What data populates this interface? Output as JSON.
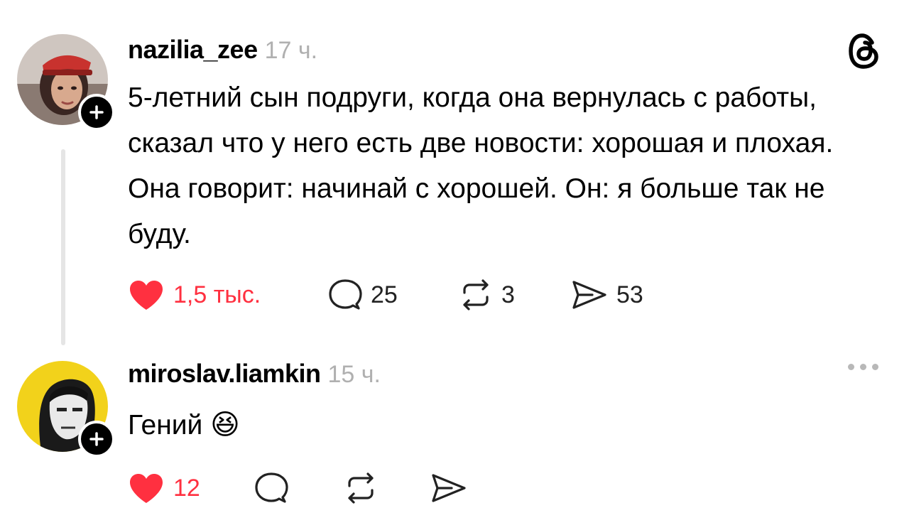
{
  "posts": [
    {
      "username": "nazilia_zee",
      "time": "17 ч.",
      "text": "5-летний сын подруги, когда она вернулась с работы, сказал что у него есть две новости: хорошая и плохая. Она говорит: начинай с хорошей. Он: я больше так не буду.",
      "likes": "1,5 тыс.",
      "comments": "25",
      "reposts": "3",
      "shares": "53",
      "liked": true
    },
    {
      "username": "miroslav.liamkin",
      "time": "15 ч.",
      "text": "Гений",
      "emoji": "😆",
      "likes": "12",
      "liked": true
    }
  ],
  "icons": {
    "logo": "threads-logo-icon",
    "like": "heart-icon",
    "comment": "comment-bubble-icon",
    "repost": "repost-icon",
    "share": "send-icon",
    "follow": "plus-icon",
    "more": "more-horizontal-icon"
  },
  "colors": {
    "like_red": "#ff3040",
    "time_gray": "#b0b0b0",
    "thread_line": "#e5e5e5",
    "avatar2_bg": "#f2d21b"
  }
}
